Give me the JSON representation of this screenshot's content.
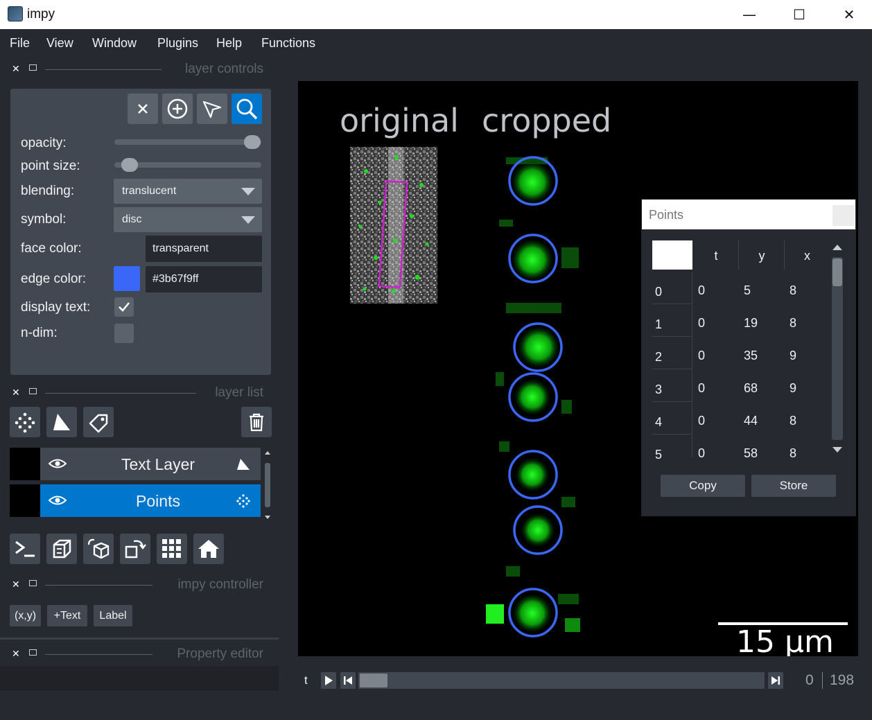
{
  "window": {
    "title": "impy"
  },
  "menu": [
    "File",
    "View",
    "Window",
    "Plugins",
    "Help",
    "Functions"
  ],
  "docks": {
    "layer_controls": "layer controls",
    "layer_list": "layer list",
    "impy_controller": "impy controller",
    "property_editor": "Property editor"
  },
  "controls": {
    "opacity_label": "opacity:",
    "opacity_value": 1.0,
    "point_size_label": "point size:",
    "point_size_value": 0.05,
    "blending_label": "blending:",
    "blending_value": "translucent",
    "symbol_label": "symbol:",
    "symbol_value": "disc",
    "face_color_label": "face color:",
    "face_color_value": "transparent",
    "edge_color_label": "edge color:",
    "edge_color_value": "#3b67f9ff",
    "edge_color_swatch": "#3b67f9",
    "display_text_label": "display text:",
    "display_text_checked": true,
    "ndim_label": "n-dim:",
    "ndim_checked": false,
    "tools": [
      "close-icon",
      "add-point-icon",
      "select-arrow-icon",
      "zoom-icon"
    ],
    "active_tool": "zoom-icon"
  },
  "layers": [
    {
      "name": "Text Layer",
      "type_icon": "shapes-icon",
      "visible": true,
      "selected": false
    },
    {
      "name": "Points",
      "type_icon": "points-icon",
      "visible": true,
      "selected": true
    }
  ],
  "impy_buttons": [
    "(x,y)",
    "+Text",
    "Label"
  ],
  "canvas": {
    "title_left": "original",
    "title_right": "cropped",
    "scalebar": "15 μm",
    "point_edge_color": "#3b67f9"
  },
  "points_widget": {
    "title": "Points",
    "columns": [
      "t",
      "y",
      "x"
    ],
    "rows": [
      {
        "index": "0",
        "t": "0",
        "y": "5",
        "x": "8"
      },
      {
        "index": "1",
        "t": "0",
        "y": "19",
        "x": "8"
      },
      {
        "index": "2",
        "t": "0",
        "y": "35",
        "x": "9"
      },
      {
        "index": "3",
        "t": "0",
        "y": "68",
        "x": "9"
      },
      {
        "index": "4",
        "t": "0",
        "y": "44",
        "x": "8"
      },
      {
        "index": "5",
        "t": "0",
        "y": "58",
        "x": "8"
      }
    ],
    "copy_label": "Copy",
    "store_label": "Store"
  },
  "dims": {
    "axis": "t",
    "current": "0",
    "max": "198",
    "position_fraction": 0.0
  }
}
